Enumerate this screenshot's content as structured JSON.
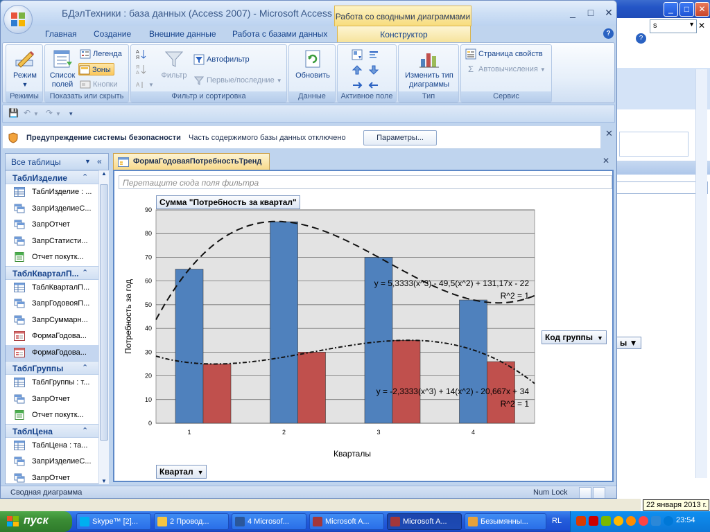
{
  "window": {
    "title": "БДэлТехники : база данных (Access 2007)",
    "app": "Microsoft Access",
    "context_tab_title": "Работа со сводными диаграммами"
  },
  "tabs": [
    "Главная",
    "Создание",
    "Внешние данные",
    "Работа с базами данных",
    "Конструктор"
  ],
  "ribbon": {
    "groups": {
      "modes": {
        "label": "Режимы",
        "view_btn": "Режим"
      },
      "showhide": {
        "label": "Показать или скрыть",
        "field_list": "Список полей",
        "legend": "Легенда",
        "zones": "Зоны",
        "buttons": "Кнопки"
      },
      "filter": {
        "label": "Фильтр и сортировка",
        "filter": "Фильтр",
        "autofilter": "Автофильтр",
        "topbottom": "Первые/последние"
      },
      "data": {
        "label": "Данные",
        "refresh": "Обновить"
      },
      "active_field": {
        "label": "Активное поле"
      },
      "type": {
        "label": "Тип",
        "change_type": "Изменить тип диаграммы"
      },
      "service": {
        "label": "Сервис",
        "property_sheet": "Страница свойств",
        "autocalc": "Автовычисления"
      }
    }
  },
  "security": {
    "warning_title": "Предупреждение системы безопасности",
    "warning_text": "Часть содержимого базы данных отключено",
    "options_btn": "Параметры..."
  },
  "nav": {
    "header": "Все таблицы",
    "groups": [
      {
        "name": "ТаблИзделие",
        "items": [
          {
            "label": "ТаблИзделие : ...",
            "type": "table"
          },
          {
            "label": "ЗапрИзделиеС...",
            "type": "query"
          },
          {
            "label": "ЗапрОтчет",
            "type": "query"
          },
          {
            "label": "ЗапрСтатисти...",
            "type": "query"
          },
          {
            "label": "Отчет покутк...",
            "type": "report"
          }
        ]
      },
      {
        "name": "ТаблКварталП...",
        "items": [
          {
            "label": "ТаблКварталП...",
            "type": "table"
          },
          {
            "label": "ЗапрГодовояП...",
            "type": "query"
          },
          {
            "label": "ЗапрСуммарн...",
            "type": "query"
          },
          {
            "label": "ФормаГодова...",
            "type": "form"
          },
          {
            "label": "ФормаГодова...",
            "type": "form",
            "selected": true
          }
        ]
      },
      {
        "name": "ТаблГруппы",
        "items": [
          {
            "label": "ТаблГруппы : т...",
            "type": "table"
          },
          {
            "label": "ЗапрОтчет",
            "type": "query"
          },
          {
            "label": "Отчет покутк...",
            "type": "report"
          }
        ]
      },
      {
        "name": "ТаблЦена",
        "items": [
          {
            "label": "ТаблЦена : та...",
            "type": "table"
          },
          {
            "label": "ЗапрИзделиеС...",
            "type": "query"
          },
          {
            "label": "ЗапрОтчет",
            "type": "query"
          }
        ]
      }
    ]
  },
  "document": {
    "tab_title": "ФормаГодоваяПотребностьТренд",
    "filter_placeholder": "Перетащите сюда поля фильтра",
    "data_field_btn": "Сумма \"Потребность за квартал\"",
    "series_field_btn": "Код группы",
    "category_field_btn": "Квартал"
  },
  "chart_data": {
    "type": "bar",
    "categories": [
      "1",
      "2",
      "3",
      "4"
    ],
    "series": [
      {
        "values": [
          65,
          85,
          70,
          52
        ],
        "color": "#4f81bd"
      },
      {
        "values": [
          25,
          30,
          35,
          26
        ],
        "color": "#c0504d"
      }
    ],
    "trendlines": [
      {
        "equation": "y = 5,3333(x^3) - 49,5(x^2) + 131,17x - 22",
        "r2": "R^2 = 1",
        "style": "dashed"
      },
      {
        "equation": "y = -2,3333(x^3) + 14(x^2) - 20,667x + 34",
        "r2": "R^2 = 1",
        "style": "dash-dot"
      }
    ],
    "xlabel": "Кварталы",
    "ylabel": "Потребность за год",
    "ylim": [
      0,
      90
    ],
    "yticks": [
      "0",
      "10",
      "20",
      "30",
      "40",
      "50",
      "60",
      "70",
      "80",
      "90"
    ],
    "grid": true
  },
  "statusbar": {
    "left": "Сводная диаграмма",
    "numlock": "Num Lock"
  },
  "taskbar": {
    "start": "пуск",
    "buttons": [
      "Skype™ [2]...",
      "2 Провод...",
      "4 Microsof...",
      "Microsoft A...",
      "Microsoft A...",
      "Безымянны..."
    ],
    "lang": "RL",
    "clock": "23:54",
    "tooltip_date": "22 января 2013 г."
  }
}
